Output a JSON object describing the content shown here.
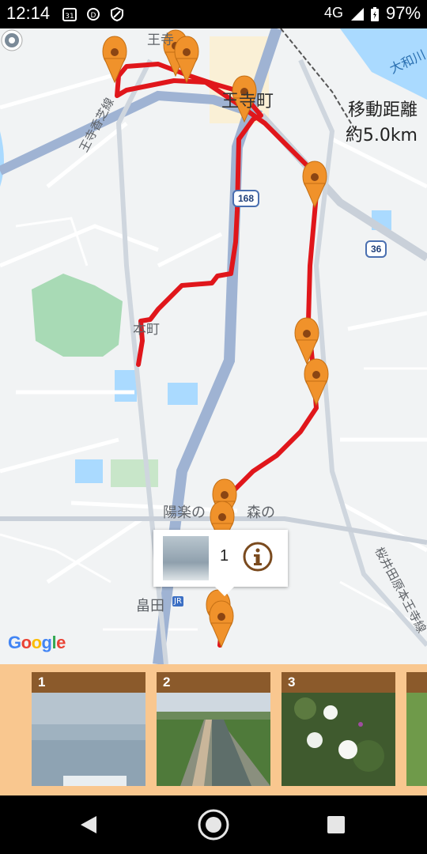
{
  "status_bar": {
    "time": "12:14",
    "calendar_badge": "31",
    "network": "4G",
    "battery": "97%"
  },
  "map": {
    "labels": {
      "ou_top": "王寺",
      "ouji_cho": "王寺町",
      "honmachi": "本町",
      "ojikasenen": "王寺香芝線",
      "yamatogawa": "大和川",
      "yoraku": "陽楽の",
      "mori": "森の",
      "hatakeda": "畠田",
      "sakurai": "桜井田原本王寺線",
      "jr": "JR",
      "route168": "168",
      "route36": "36"
    },
    "distance_label": "移動距離",
    "distance_value": "約5.0km",
    "google_logo": "Google",
    "route_color": "#e0161b",
    "marker_color": "#f0922b"
  },
  "info_window": {
    "count": "1",
    "info_icon": "info-icon"
  },
  "photo_strip": {
    "items": [
      {
        "number": "1",
        "scene": "blurry-wall"
      },
      {
        "number": "2",
        "scene": "river-canal"
      },
      {
        "number": "3",
        "scene": "white-flowers"
      }
    ]
  },
  "nav_bar": {
    "back": "back-icon",
    "home": "home-icon",
    "recents": "recents-icon"
  }
}
